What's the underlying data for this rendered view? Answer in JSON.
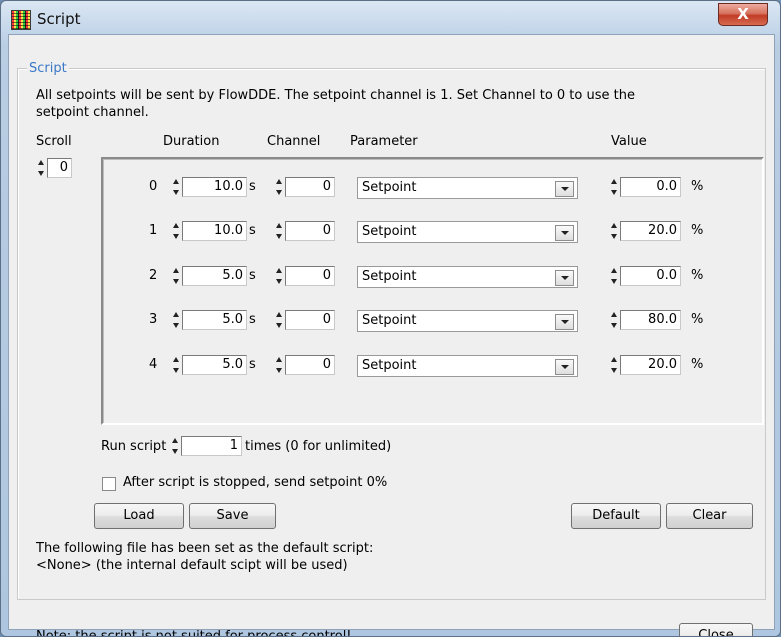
{
  "window": {
    "title": "Script",
    "close_glyph": "X",
    "icon": "app-led-icon"
  },
  "group": {
    "title": "Script",
    "info_line1": "All setpoints will be sent by FlowDDE. The setpoint channel is 1. Set Channel to 0 to use the",
    "info_line2": "setpoint channel."
  },
  "columns": {
    "scroll": "Scroll",
    "duration": "Duration",
    "channel": "Channel",
    "parameter": "Parameter",
    "value": "Value"
  },
  "scroll_value": "0",
  "rows": [
    {
      "index": "0",
      "duration": "10.0",
      "duration_unit": "s",
      "channel": "0",
      "parameter": "Setpoint",
      "value": "0.0",
      "value_unit": "%"
    },
    {
      "index": "1",
      "duration": "10.0",
      "duration_unit": "s",
      "channel": "0",
      "parameter": "Setpoint",
      "value": "20.0",
      "value_unit": "%"
    },
    {
      "index": "2",
      "duration": "5.0",
      "duration_unit": "s",
      "channel": "0",
      "parameter": "Setpoint",
      "value": "0.0",
      "value_unit": "%"
    },
    {
      "index": "3",
      "duration": "5.0",
      "duration_unit": "s",
      "channel": "0",
      "parameter": "Setpoint",
      "value": "80.0",
      "value_unit": "%"
    },
    {
      "index": "4",
      "duration": "5.0",
      "duration_unit": "s",
      "channel": "0",
      "parameter": "Setpoint",
      "value": "20.0",
      "value_unit": "%"
    }
  ],
  "run": {
    "label": "Run script",
    "count": "1",
    "suffix": "times (0 for unlimited)"
  },
  "after_stop": {
    "label": "After script is stopped, send setpoint 0%",
    "checked": false
  },
  "buttons": {
    "load": "Load",
    "save": "Save",
    "default": "Default",
    "clear": "Clear",
    "close": "Close"
  },
  "default_note": {
    "line1": "The following file has been set as the default script:",
    "line2": "<None> (the internal default scipt will be used)"
  },
  "footer_note": "Note: the script is not suited for process control!"
}
